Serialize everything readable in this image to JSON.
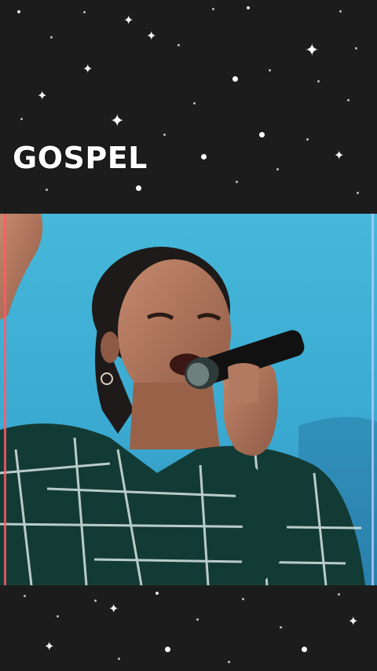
{
  "title": "GOSPEL",
  "colors": {
    "background": "#1c1c1c",
    "title": "#ffffff",
    "stage_blue": "#3bb3d8",
    "shirt": "#123a33"
  },
  "video": {
    "description_icon": "singer-video-frame"
  }
}
